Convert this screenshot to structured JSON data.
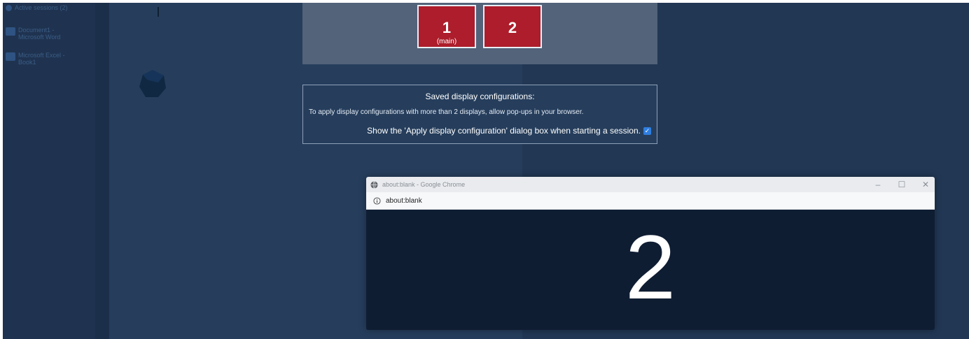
{
  "sidebar": {
    "items": [
      {
        "label": "Active sessions (2)",
        "icon": "session-icon"
      },
      {
        "label": "Document1 - Microsoft Word",
        "icon": "word-icon"
      },
      {
        "label": "Microsoft Excel - Book1",
        "icon": "excel-icon"
      }
    ]
  },
  "display_panel": {
    "monitors": [
      {
        "number": "1",
        "sublabel": "(main)"
      },
      {
        "number": "2",
        "sublabel": ""
      }
    ],
    "monitor_color": "#ad1d2b"
  },
  "saved_configs": {
    "title": "Saved display configurations:",
    "hint": "To apply display configurations with more than 2 displays, allow pop-ups in your browser.",
    "checkbox_label": "Show the 'Apply display configuration' dialog box when starting a session.",
    "checkbox_checked": true
  },
  "chrome_popup": {
    "window_title": "about:blank - Google Chrome",
    "address": "about:blank",
    "controls": {
      "minimize": "–",
      "maximize": "☐",
      "close": "✕"
    },
    "display_number": "2"
  },
  "colors": {
    "background": "#213754",
    "accent_red": "#ad1d2b",
    "checkbox_blue": "#2f7ee0"
  }
}
